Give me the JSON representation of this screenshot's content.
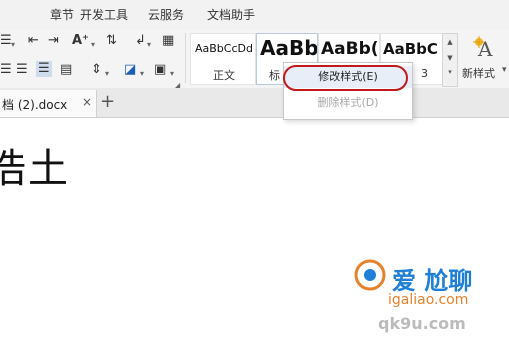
{
  "menubar": {
    "items": [
      "章节",
      "开发工具",
      "云服务",
      "文档助手"
    ]
  },
  "ribbon": {
    "styles": [
      {
        "sample": "AaBbCcDd",
        "name": "正文"
      },
      {
        "sample": "AaBb",
        "name": "标"
      },
      {
        "sample": "AaBb(",
        "name": ""
      },
      {
        "sample": "AaBbC",
        "name": "3"
      }
    ],
    "new_style_label": "新样式",
    "new_style_arrow": "▾"
  },
  "context_menu": {
    "modify": "修改样式(E)",
    "delete": "删除样式(D)"
  },
  "tabs": {
    "doc_title": "档 (2).docx",
    "close": "×",
    "add": "+"
  },
  "document": {
    "text": "浩土"
  },
  "watermark": {
    "line1": "爱 尬聊",
    "line2": "igaliao.com",
    "line3": "qk9u.com"
  },
  "colors": {
    "highlight_ring": "#c11a1a",
    "watermark_orange": "#e8822a",
    "watermark_blue": "#1f7fd6"
  }
}
